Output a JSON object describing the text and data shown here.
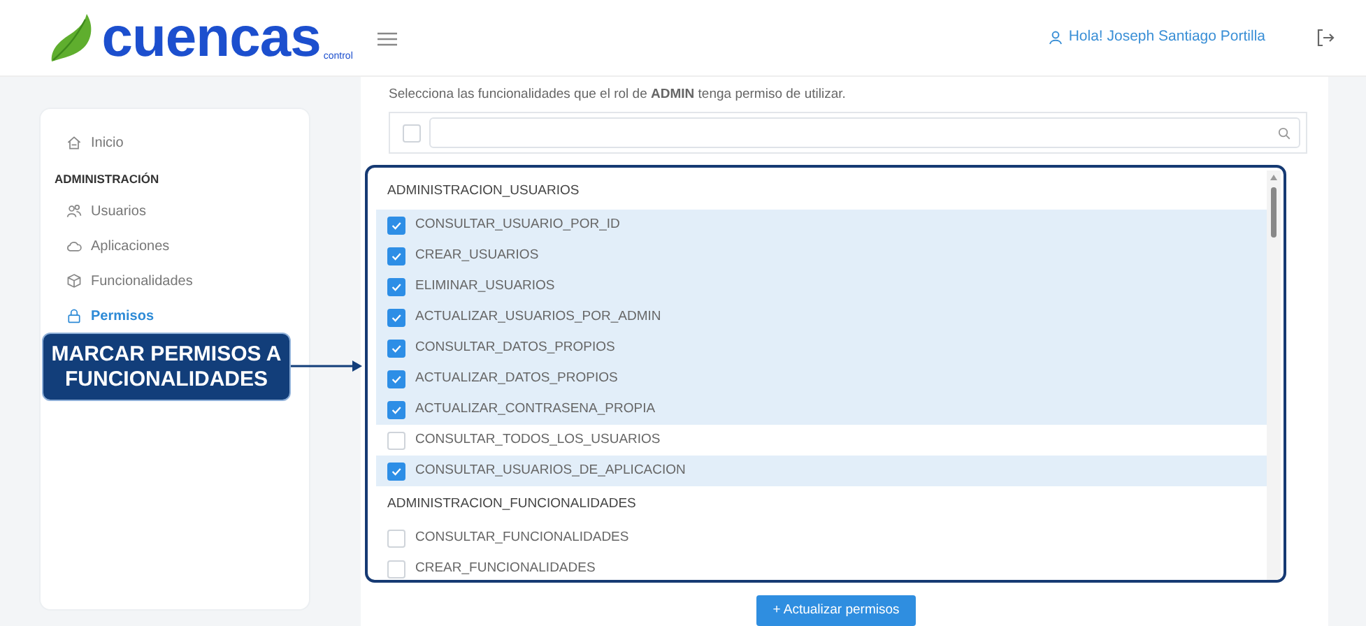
{
  "header": {
    "logo_text": "cuencas",
    "logo_subtext": "control",
    "user_greeting": "Hola! Joseph Santiago Portilla"
  },
  "sidebar": {
    "items": [
      {
        "kind": "link",
        "label": "Inicio",
        "selected": false
      },
      {
        "kind": "header",
        "label": "ADMINISTRACIÓN"
      },
      {
        "kind": "link",
        "label": "Usuarios",
        "selected": false
      },
      {
        "kind": "link",
        "label": "Aplicaciones",
        "selected": false
      },
      {
        "kind": "link",
        "label": "Funcionalidades",
        "selected": false
      },
      {
        "kind": "link",
        "label": "Permisos",
        "selected": true
      }
    ]
  },
  "main": {
    "instruction": "Selecciona las funcionalidades que el rol de **ADMIN** tenga permiso de utilizar.",
    "select_all_checked": false,
    "list": [
      {
        "kind": "group",
        "label": "ADMINISTRACION_USUARIOS"
      },
      {
        "kind": "option",
        "label": "CONSULTAR_USUARIO_POR_ID",
        "checked": true
      },
      {
        "kind": "option",
        "label": "CREAR_USUARIOS",
        "checked": true
      },
      {
        "kind": "option",
        "label": "ELIMINAR_USUARIOS",
        "checked": true
      },
      {
        "kind": "option",
        "label": "ACTUALIZAR_USUARIOS_POR_ADMIN",
        "checked": true
      },
      {
        "kind": "option",
        "label": "CONSULTAR_DATOS_PROPIOS",
        "checked": true
      },
      {
        "kind": "option",
        "label": "ACTUALIZAR_DATOS_PROPIOS",
        "checked": true
      },
      {
        "kind": "option",
        "label": "ACTUALIZAR_CONTRASENA_PROPIA",
        "checked": true
      },
      {
        "kind": "option",
        "label": "CONSULTAR_TODOS_LOS_USUARIOS",
        "checked": false
      },
      {
        "kind": "option",
        "label": "CONSULTAR_USUARIOS_DE_APLICACION",
        "checked": true
      },
      {
        "kind": "group",
        "label": "ADMINISTRACION_FUNCIONALIDADES"
      },
      {
        "kind": "option",
        "label": "CONSULTAR_FUNCIONALIDADES",
        "checked": false
      },
      {
        "kind": "option",
        "label": "CREAR_FUNCIONALIDADES",
        "checked": false
      }
    ],
    "submit_button": "+ Actualizar permisos"
  },
  "callout": {
    "text": "MARCAR PERMISOS A FUNCIONALIDADES"
  }
}
